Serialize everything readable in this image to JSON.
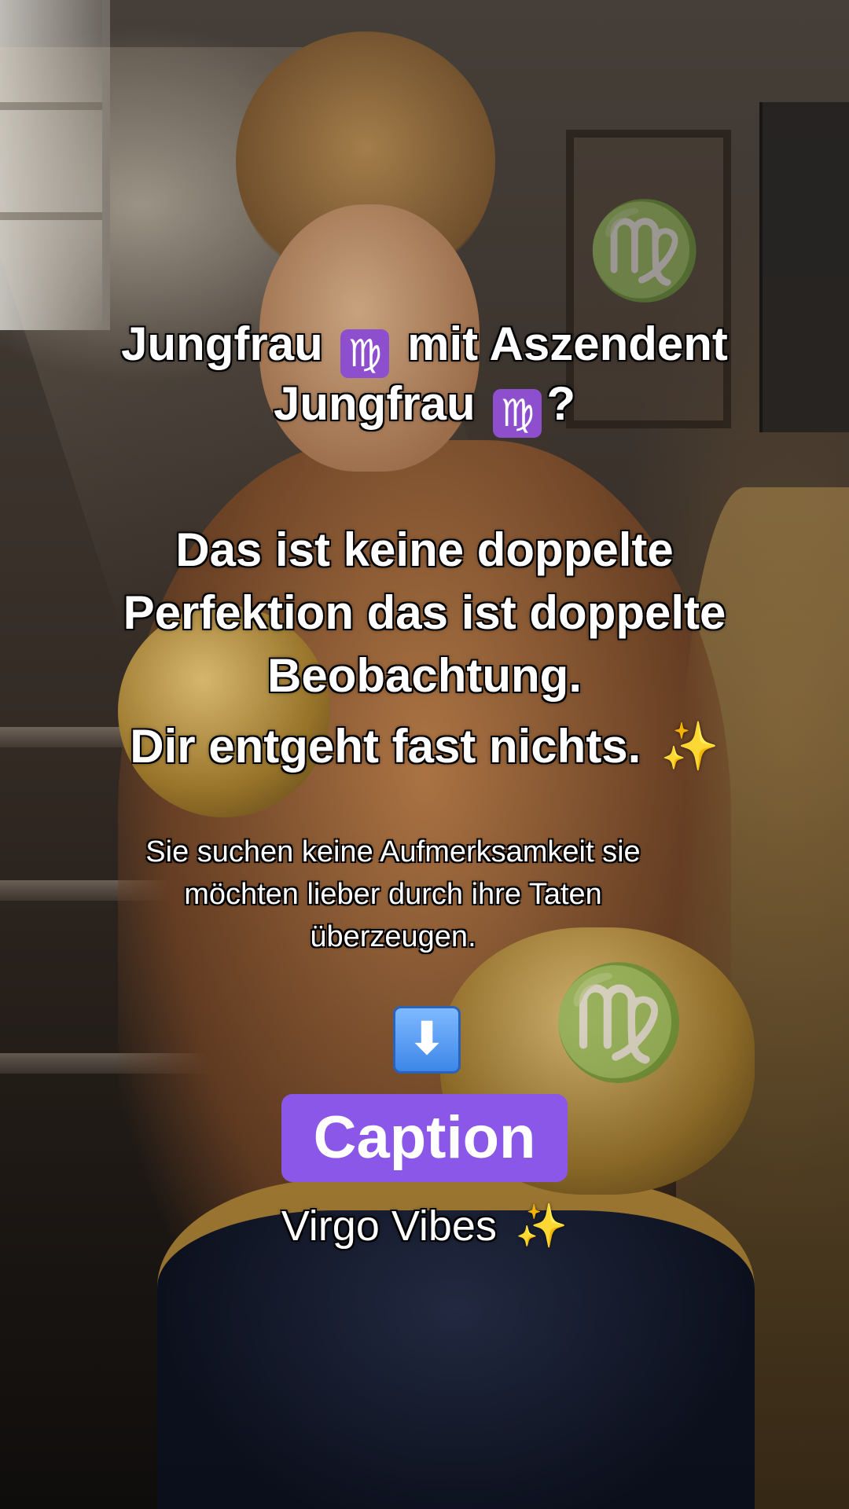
{
  "post": {
    "headline": {
      "line1_before": "Jungfrau",
      "line1_after": "mit Aszendent",
      "line2_before": "Jungfrau",
      "line2_after": "?",
      "zodiac_symbol": "♍"
    },
    "body": {
      "line1": "Das ist keine doppelte",
      "line2": "Perfektion das ist doppelte",
      "line3": "Beobachtung.",
      "line4": "Dir entgeht fast nichts.",
      "sparkle": "✨"
    },
    "subtext": {
      "line1": "Sie suchen keine Aufmerksamkeit sie",
      "line2": "möchten lieber durch ihre Taten",
      "line3": "überzeugen."
    },
    "arrow_symbol": "⬇",
    "caption_label": "Caption",
    "vibes_text": "Virgo Vibes",
    "vibes_sparkle": "✨",
    "icons": {
      "zodiac": "virgo-emoji-icon",
      "sparkle": "sparkles-emoji-icon",
      "arrow": "down-arrow-emoji-icon"
    },
    "colors": {
      "zodiac_badge": "#8e4fcf",
      "caption_pill": "#8a57e8",
      "arrow_box": "#3d86e8",
      "sparkle": "#ffd23a",
      "text": "#ffffff"
    }
  }
}
